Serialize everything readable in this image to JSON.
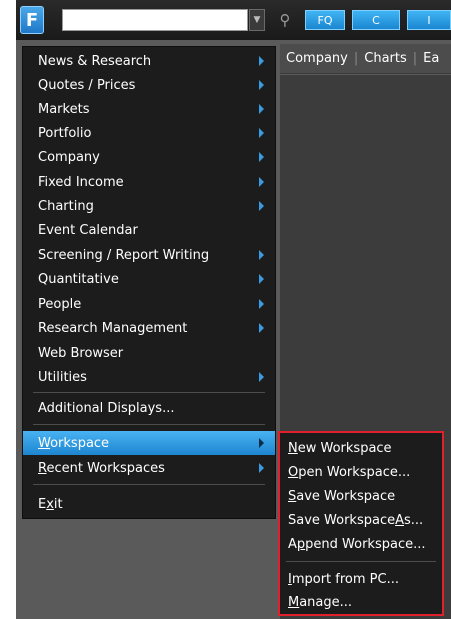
{
  "toolbar": {
    "logo_letter": "F",
    "ticker_value": "",
    "buttons": [
      "FQ",
      "C",
      "I"
    ]
  },
  "tabs": [
    "Company",
    "Charts",
    "Ea"
  ],
  "menu": {
    "items": [
      {
        "label": "News & Research",
        "submenu": true
      },
      {
        "label": "Quotes / Prices",
        "submenu": true
      },
      {
        "label": "Markets",
        "submenu": true
      },
      {
        "label": "Portfolio",
        "submenu": true
      },
      {
        "label": "Company",
        "submenu": true
      },
      {
        "label": "Fixed Income",
        "submenu": true
      },
      {
        "label": "Charting",
        "submenu": true
      },
      {
        "label": "Event Calendar",
        "submenu": false
      },
      {
        "label": "Screening / Report Writing",
        "submenu": true
      },
      {
        "label": "Quantitative",
        "submenu": true
      },
      {
        "label": "People",
        "submenu": true
      },
      {
        "label": "Research Management",
        "submenu": true
      },
      {
        "label": "Web Browser",
        "submenu": false
      },
      {
        "label": "Utilities",
        "submenu": true
      }
    ],
    "additional": "Additional Displays...",
    "workspace": {
      "first": "W",
      "rest": "orkspace"
    },
    "recent": {
      "first": "R",
      "rest": "ecent Workspaces"
    },
    "exit": {
      "pre": "E",
      "mid": "x",
      "post": "it"
    }
  },
  "workspace_submenu": {
    "new": {
      "pre": "",
      "key": "N",
      "post": "ew Workspace"
    },
    "open": {
      "pre": "",
      "key": "O",
      "post": "pen Workspace..."
    },
    "save": {
      "pre": "",
      "key": "S",
      "post": "ave Workspace"
    },
    "save_as": {
      "pre": "Save Workspace ",
      "key": "A",
      "post": "s..."
    },
    "append": {
      "pre": "A",
      "key": "p",
      "post": "pend Workspace..."
    },
    "import": {
      "pre": "",
      "key": "I",
      "post": "mport from PC..."
    },
    "manage": {
      "pre": "",
      "key": "M",
      "post": "anage..."
    }
  },
  "colors": {
    "accent": "#2a9be6",
    "highlight_border": "#e0202a",
    "menu_bg": "#1c1c1c"
  }
}
